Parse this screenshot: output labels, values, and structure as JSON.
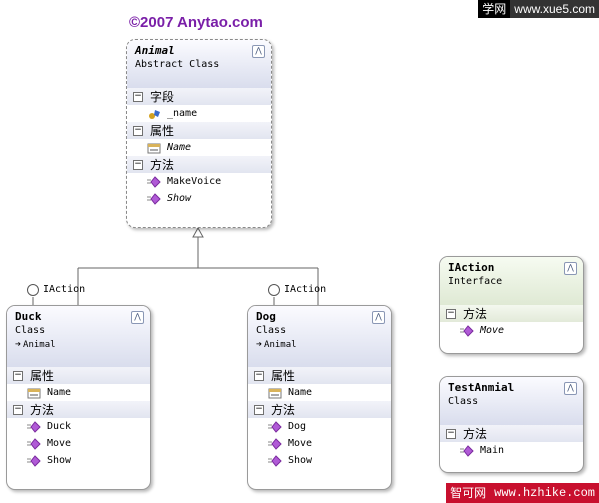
{
  "header": {
    "title": "©2007 Anytao.com"
  },
  "watermarks": {
    "top_left": "学网",
    "top_right": "www.xue5.com",
    "bottom_left": "智可网",
    "bottom_right": "www.hzhike.com"
  },
  "icons": {
    "collapse": "double-chevron-up-icon",
    "field": "field-icon",
    "property": "property-icon",
    "method": "method-icon",
    "inherit": "arrow-right-icon"
  },
  "colors": {
    "title": "#7a1fa8",
    "header_gradient_class": "#d9dded",
    "header_gradient_interface": "#dfe9d4",
    "method_icon": "#b05ad6"
  },
  "animal": {
    "name": "Animal",
    "type": "Abstract Class",
    "sections": {
      "fields": {
        "label": "字段",
        "items": [
          "_name"
        ]
      },
      "properties": {
        "label": "属性",
        "items": [
          "Name"
        ]
      },
      "methods": {
        "label": "方法",
        "items": [
          "MakeVoice",
          "Show"
        ]
      }
    }
  },
  "duck": {
    "name": "Duck",
    "type": "Class",
    "base": "Animal",
    "interface_label": "IAction",
    "sections": {
      "properties": {
        "label": "属性",
        "items": [
          "Name"
        ]
      },
      "methods": {
        "label": "方法",
        "items": [
          "Duck",
          "Move",
          "Show"
        ]
      }
    }
  },
  "dog": {
    "name": "Dog",
    "type": "Class",
    "base": "Animal",
    "interface_label": "IAction",
    "sections": {
      "properties": {
        "label": "属性",
        "items": [
          "Name"
        ]
      },
      "methods": {
        "label": "方法",
        "items": [
          "Dog",
          "Move",
          "Show"
        ]
      }
    }
  },
  "iaction": {
    "name": "IAction",
    "type": "Interface",
    "sections": {
      "methods": {
        "label": "方法",
        "items": [
          "Move"
        ]
      }
    }
  },
  "testanmial": {
    "name": "TestAnmial",
    "type": "Class",
    "sections": {
      "methods": {
        "label": "方法",
        "items": [
          "Main"
        ]
      }
    }
  }
}
